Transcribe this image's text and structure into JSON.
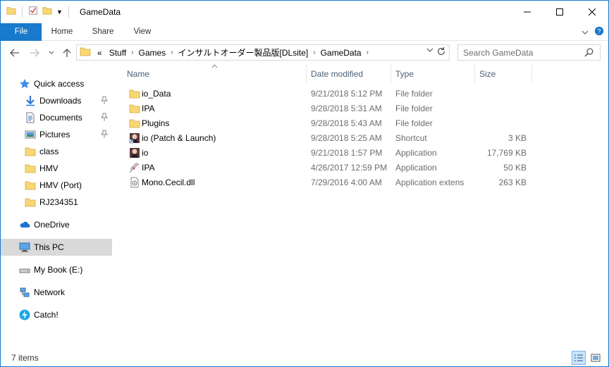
{
  "window": {
    "title": "GameData"
  },
  "ribbon": {
    "tabs": [
      "File",
      "Home",
      "Share",
      "View"
    ]
  },
  "address": {
    "overflow": "«",
    "crumbs": [
      "Stuff",
      "Games",
      "インサルトオーダー製品版[DLsite]",
      "GameData"
    ]
  },
  "search": {
    "placeholder": "Search GameData"
  },
  "nav": {
    "quick_access": "Quick access",
    "items": [
      {
        "label": "Downloads",
        "pinned": true
      },
      {
        "label": "Documents",
        "pinned": true
      },
      {
        "label": "Pictures",
        "pinned": true
      },
      {
        "label": "class",
        "pinned": false
      },
      {
        "label": "HMV",
        "pinned": false
      },
      {
        "label": "HMV (Port)",
        "pinned": false
      },
      {
        "label": "RJ234351",
        "pinned": false
      }
    ],
    "onedrive": "OneDrive",
    "thispc": "This PC",
    "mybook": "My Book (E:)",
    "network": "Network",
    "catch": "Catch!"
  },
  "columns": {
    "name": "Name",
    "date": "Date modified",
    "type": "Type",
    "size": "Size"
  },
  "files": [
    {
      "name": "io_Data",
      "date": "9/21/2018 5:12 PM",
      "type": "File folder",
      "size": "",
      "icon": "folder-icon"
    },
    {
      "name": "IPA",
      "date": "9/28/2018 5:31 AM",
      "type": "File folder",
      "size": "",
      "icon": "folder-icon"
    },
    {
      "name": "Plugins",
      "date": "9/28/2018 5:43 AM",
      "type": "File folder",
      "size": "",
      "icon": "folder-icon"
    },
    {
      "name": "io (Patch & Launch)",
      "date": "9/28/2018 5:25 AM",
      "type": "Shortcut",
      "size": "3 KB",
      "icon": "shortcut-icon"
    },
    {
      "name": "io",
      "date": "9/21/2018 1:57 PM",
      "type": "Application",
      "size": "17,769 KB",
      "icon": "app-icon"
    },
    {
      "name": "IPA",
      "date": "4/26/2017 12:59 PM",
      "type": "Application",
      "size": "50 KB",
      "icon": "syringe-icon"
    },
    {
      "name": "Mono.Cecil.dll",
      "date": "7/29/2016 4:00 AM",
      "type": "Application extens",
      "size": "263 KB",
      "icon": "dll-icon"
    }
  ],
  "status": {
    "count": "7 items"
  },
  "colors": {
    "accent": "#1979ca",
    "folder": "#f8d775",
    "selected": "#d9d9d9"
  }
}
